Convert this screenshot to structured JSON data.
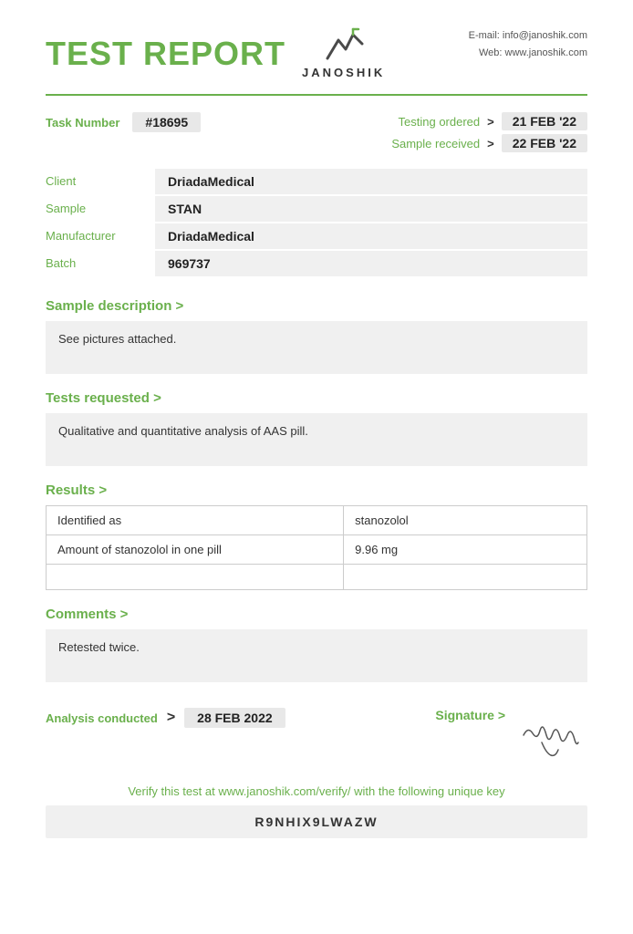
{
  "header": {
    "title": "TEST REPORT",
    "logo_name": "JANOSHIK",
    "contact_email": "E-mail:  info@janoshik.com",
    "contact_web": "Web:  www.janoshik.com"
  },
  "task": {
    "label": "Task Number",
    "number": "#18695",
    "testing_ordered_label": "Testing ordered",
    "testing_ordered_value": "21 FEB '22",
    "sample_received_label": "Sample received",
    "sample_received_value": "22 FEB '22"
  },
  "client_info": {
    "client_label": "Client",
    "client_value": "DriadaMedical",
    "sample_label": "Sample",
    "sample_value": "STAN",
    "manufacturer_label": "Manufacturer",
    "manufacturer_value": "DriadaMedical",
    "batch_label": "Batch",
    "batch_value": "969737"
  },
  "sample_description": {
    "header": "Sample description >",
    "text": "See pictures attached."
  },
  "tests_requested": {
    "header": "Tests requested >",
    "text": "Qualitative and quantitative analysis of AAS pill."
  },
  "results": {
    "header": "Results >",
    "rows": [
      {
        "col1": "Identified as",
        "col2": "stanozolol"
      },
      {
        "col1": "Amount of stanozolol in one pill",
        "col2": "9.96 mg"
      },
      {
        "col1": "",
        "col2": ""
      }
    ]
  },
  "comments": {
    "header": "Comments >",
    "text": "Retested twice."
  },
  "analysis": {
    "label": "Analysis conducted",
    "arrow": ">",
    "value": "28 FEB 2022"
  },
  "signature": {
    "label": "Signature >"
  },
  "verify": {
    "text": "Verify this test at www.janoshik.com/verify/ with the following unique key",
    "key": "R9NHIX9LWAZW"
  }
}
